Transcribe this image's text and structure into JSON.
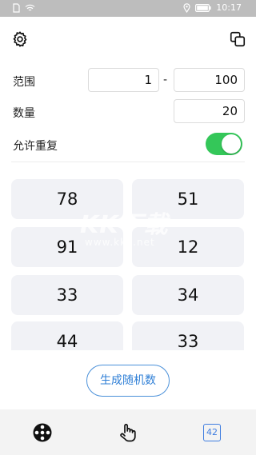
{
  "status_bar": {
    "time": "10:17"
  },
  "form": {
    "range_label": "范围",
    "range_min": "1",
    "range_separator": "-",
    "range_max": "100",
    "count_label": "数量",
    "count_value": "20",
    "repeat_label": "允许重复",
    "repeat_enabled": true
  },
  "results": [
    "78",
    "51",
    "91",
    "12",
    "33",
    "34",
    "44",
    "33"
  ],
  "watermark": {
    "logo": "KK下载",
    "url": "www.kkx.net"
  },
  "generate_button": "生成随机数",
  "bottom_nav": {
    "number_badge": "42"
  },
  "colors": {
    "toggle_on": "#34c759",
    "accent": "#2f7fd6",
    "cell_bg": "#f1f2f6"
  }
}
